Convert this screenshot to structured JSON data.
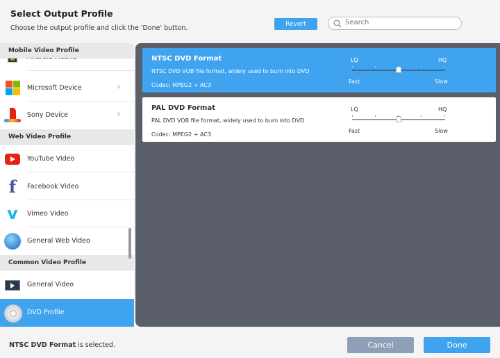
{
  "header": {
    "title": "Select Output Profile",
    "subtitle": "Choose the output profile and click the 'Done' button.",
    "revert_label": "Revert",
    "search_placeholder": "Search"
  },
  "sidebar": {
    "headers": [
      "Mobile Video Profile",
      "Web Video Profile",
      "Common Video Profile"
    ],
    "items": [
      {
        "label": "Android Mobile",
        "icon": "android-icon"
      },
      {
        "label": "Microsoft Device",
        "icon": "microsoft-icon"
      },
      {
        "label": "Sony Device",
        "icon": "playstation-icon"
      },
      {
        "label": "YouTube Video",
        "icon": "youtube-icon"
      },
      {
        "label": "Facebook Video",
        "icon": "facebook-icon"
      },
      {
        "label": "Vimeo Video",
        "icon": "vimeo-icon"
      },
      {
        "label": "General Web Video",
        "icon": "globe-icon"
      },
      {
        "label": "General Video",
        "icon": "video-icon"
      },
      {
        "label": "DVD Profile",
        "icon": "dvd-icon",
        "selected": true
      }
    ]
  },
  "profiles": [
    {
      "name": "NTSC DVD Format",
      "desc": "NTSC DVD VOB file format, widely used to burn into DVD",
      "codec": "Codec: MPEG2 + AC3",
      "lq": "LQ",
      "hq": "HQ",
      "fast": "Fast",
      "slow": "Slow",
      "quality": 0.5,
      "selected": true
    },
    {
      "name": "PAL DVD Format",
      "desc": "PAL DVD VOB file format, widely used to burn into DVD",
      "codec": "Codec: MPEG2 + AC3",
      "lq": "LQ",
      "hq": "HQ",
      "fast": "Fast",
      "slow": "Slow",
      "quality": 0.5
    }
  ],
  "footer": {
    "status_name": "NTSC DVD Format",
    "status_suffix": " is selected.",
    "cancel_label": "Cancel",
    "done_label": "Done"
  },
  "colors": {
    "accent": "#3fa3ef",
    "content_bg": "#5a5f6b"
  }
}
